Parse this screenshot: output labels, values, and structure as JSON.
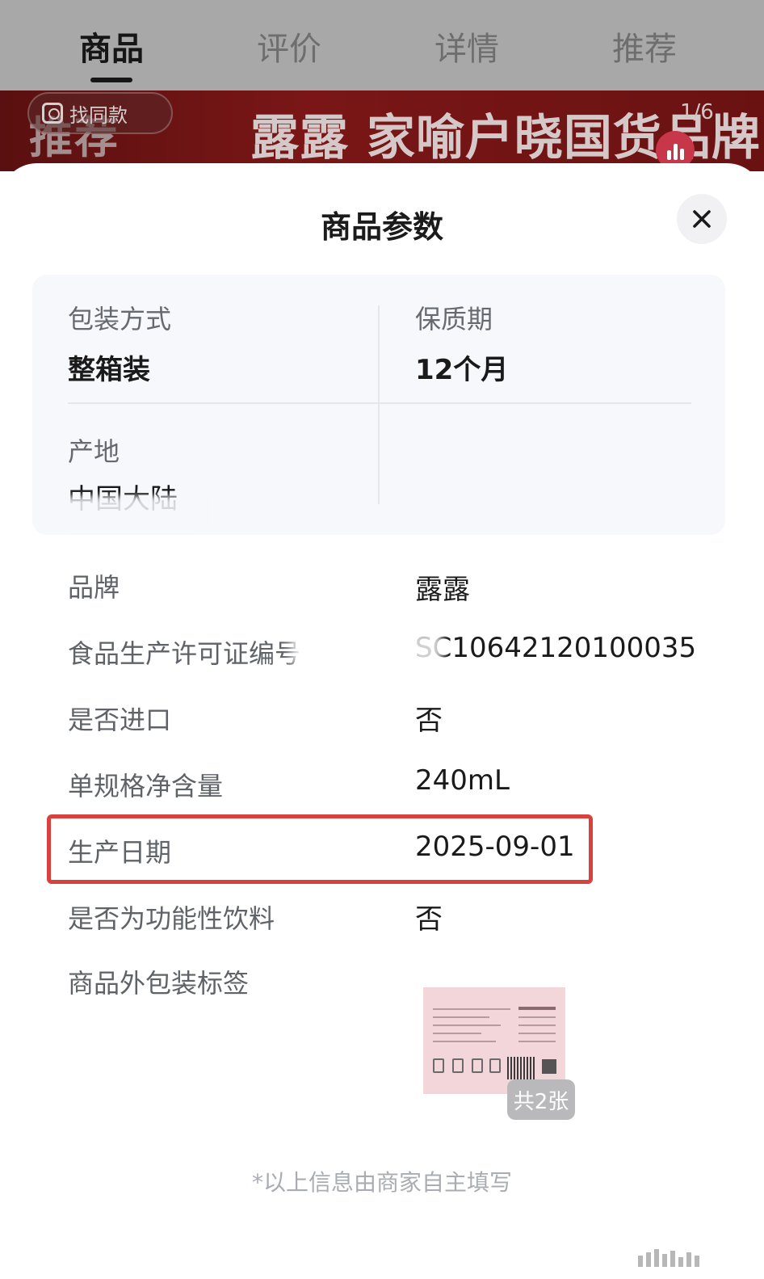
{
  "tabs": [
    {
      "label": "商品",
      "active": true
    },
    {
      "label": "评价",
      "active": false
    },
    {
      "label": "详情",
      "active": false
    },
    {
      "label": "推荐",
      "active": false
    }
  ],
  "banner": {
    "tag": "推荐",
    "find_similar": "找同款",
    "title": "露露 家喻户晓国货品牌",
    "page_indicator": "1/6"
  },
  "sheet": {
    "title": "商品参数",
    "grid": {
      "packaging_label": "包装方式",
      "packaging_value": "整箱装",
      "shelf_life_label": "保质期",
      "shelf_life_value": "12个月",
      "origin_label": "产地",
      "origin_value": "中国大陆"
    },
    "rows": [
      {
        "label": "品牌",
        "value": "露露"
      },
      {
        "label": "食品生产许可证编号",
        "value": "SC10642120100035"
      },
      {
        "label": "是否进口",
        "value": "否"
      },
      {
        "label": "单规格净含量",
        "value": "240mL"
      },
      {
        "label": "生产日期",
        "value": "2025-09-01"
      },
      {
        "label": "是否为功能性饮料",
        "value": "否"
      },
      {
        "label": "商品外包装标签",
        "value": ""
      }
    ],
    "label_image_count": "共2张",
    "footer_note": "*以上信息由商家自主填写"
  },
  "colors": {
    "highlight": "#d9413f",
    "banner": "#7a1616"
  }
}
